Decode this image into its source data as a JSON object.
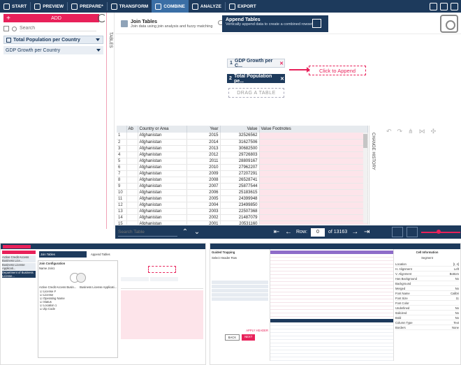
{
  "nav": {
    "items": [
      {
        "label": "START",
        "icon": "home-icon"
      },
      {
        "label": "PREVIEW",
        "icon": "eye-icon"
      },
      {
        "label": "PREPARE*",
        "icon": "prepare-icon"
      },
      {
        "label": "TRANSFORM",
        "icon": "transform-icon"
      },
      {
        "label": "COMBINE",
        "icon": "combine-icon"
      },
      {
        "label": "ANALYZE",
        "icon": "analyze-icon"
      },
      {
        "label": "EXPORT",
        "icon": "export-icon"
      }
    ],
    "active": "COMBINE",
    "accent": "#3a6ea5",
    "bg": "#1d3a5c"
  },
  "left": {
    "add_label": "ADD",
    "search_placeholder": "Search",
    "tables": [
      "Total Population per Country",
      "GDP Growth per Country"
    ],
    "tables_tab": "TABLES"
  },
  "combine": {
    "join_title": "Join Tables",
    "join_desc": "Join data using join analysis and fuzzy matching",
    "append_title": "Append Tables",
    "append_desc": "Vertically append data to create a combined rowset",
    "stack": [
      {
        "num": "1",
        "label": "GDP Growth per C..."
      },
      {
        "num": "2",
        "label": "Total Population pe..."
      }
    ],
    "click_append": "Click to Append",
    "drag_table": "DRAG A TABLE",
    "accent": "#e8215a"
  },
  "grid": {
    "columns": [
      "Ab",
      "Country or Area",
      "Year",
      "Value",
      "Value Footnotes"
    ],
    "rows": [
      [
        "1",
        "Afghanistan",
        "2015",
        "32526562"
      ],
      [
        "2",
        "Afghanistan",
        "2014",
        "31627506"
      ],
      [
        "3",
        "Afghanistan",
        "2013",
        "30682500"
      ],
      [
        "4",
        "Afghanistan",
        "2012",
        "29726803"
      ],
      [
        "5",
        "Afghanistan",
        "2011",
        "28809167"
      ],
      [
        "6",
        "Afghanistan",
        "2010",
        "27962207"
      ],
      [
        "7",
        "Afghanistan",
        "2009",
        "27207291"
      ],
      [
        "8",
        "Afghanistan",
        "2008",
        "26528741"
      ],
      [
        "9",
        "Afghanistan",
        "2007",
        "25877544"
      ],
      [
        "10",
        "Afghanistan",
        "2006",
        "25183615"
      ],
      [
        "11",
        "Afghanistan",
        "2005",
        "24399948"
      ],
      [
        "12",
        "Afghanistan",
        "2004",
        "23499850"
      ],
      [
        "13",
        "Afghanistan",
        "2003",
        "22507368"
      ],
      [
        "14",
        "Afghanistan",
        "2002",
        "21487079"
      ],
      [
        "15",
        "Afghanistan",
        "2001",
        "20531160"
      ],
      [
        "16",
        "Afghanistan",
        "2000",
        "19701940"
      ]
    ]
  },
  "history": {
    "label": "CHANGE HISTORY"
  },
  "bottom": {
    "search_placeholder": "Search Table",
    "row_label": "Row:",
    "row_value": "0",
    "row_total": "of 13163"
  },
  "thumb1": {
    "left_items": [
      "Active Credit Access Business Lice...",
      "Business License Applicati...",
      "Department of Business License..."
    ],
    "join_title": "Join Tables",
    "append_title": "Append Tables",
    "config_title": "Join Configuration",
    "name_value": "Join1",
    "left_cols": [
      "Active Credit Access Busin...",
      "Business License Applicati..."
    ],
    "field_list": [
      "License #",
      "License",
      "Operating Name",
      "Status",
      "Location 1",
      "Zip Code"
    ]
  },
  "thumb2": {
    "guided_title": "Guided Trapping",
    "select_header": "Select Header Row",
    "buttons": [
      "BACK",
      "NEXT"
    ],
    "apply_label": "APPLY HEADER",
    "panel_title": "Cell Information",
    "segment": "Segment",
    "props": [
      [
        "Location",
        "[I, 4]"
      ],
      [
        "H. Alignment",
        "Left"
      ],
      [
        "V. Alignment",
        "Bottom"
      ],
      [
        "Has Background",
        "No"
      ],
      [
        "Background",
        ""
      ],
      [
        "Merged",
        "No"
      ],
      [
        "Font Name",
        "Calibri"
      ],
      [
        "Font Size",
        "11"
      ],
      [
        "Font Color",
        ""
      ],
      [
        "Underlined",
        "No"
      ],
      [
        "Italicized",
        "No"
      ],
      [
        "Bold",
        "No"
      ],
      [
        "Column Type",
        "Text"
      ],
      [
        "Borders",
        "None"
      ]
    ]
  }
}
